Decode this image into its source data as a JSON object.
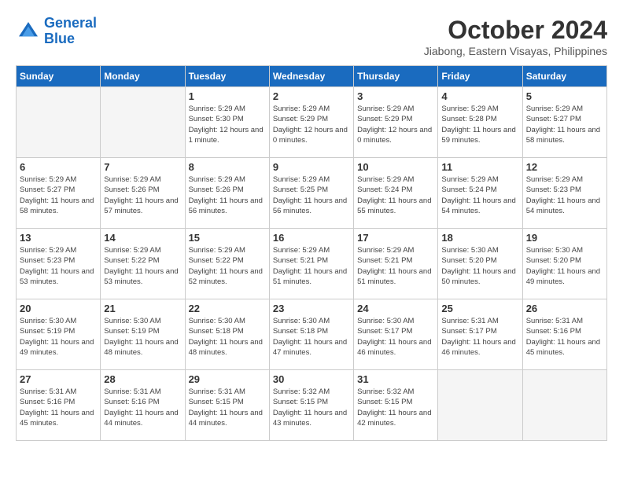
{
  "logo": {
    "line1": "General",
    "line2": "Blue"
  },
  "title": "October 2024",
  "subtitle": "Jiabong, Eastern Visayas, Philippines",
  "weekdays": [
    "Sunday",
    "Monday",
    "Tuesday",
    "Wednesday",
    "Thursday",
    "Friday",
    "Saturday"
  ],
  "weeks": [
    [
      {
        "day": "",
        "sunrise": "",
        "sunset": "",
        "daylight": ""
      },
      {
        "day": "",
        "sunrise": "",
        "sunset": "",
        "daylight": ""
      },
      {
        "day": "1",
        "sunrise": "Sunrise: 5:29 AM",
        "sunset": "Sunset: 5:30 PM",
        "daylight": "Daylight: 12 hours and 1 minute."
      },
      {
        "day": "2",
        "sunrise": "Sunrise: 5:29 AM",
        "sunset": "Sunset: 5:29 PM",
        "daylight": "Daylight: 12 hours and 0 minutes."
      },
      {
        "day": "3",
        "sunrise": "Sunrise: 5:29 AM",
        "sunset": "Sunset: 5:29 PM",
        "daylight": "Daylight: 12 hours and 0 minutes."
      },
      {
        "day": "4",
        "sunrise": "Sunrise: 5:29 AM",
        "sunset": "Sunset: 5:28 PM",
        "daylight": "Daylight: 11 hours and 59 minutes."
      },
      {
        "day": "5",
        "sunrise": "Sunrise: 5:29 AM",
        "sunset": "Sunset: 5:27 PM",
        "daylight": "Daylight: 11 hours and 58 minutes."
      }
    ],
    [
      {
        "day": "6",
        "sunrise": "Sunrise: 5:29 AM",
        "sunset": "Sunset: 5:27 PM",
        "daylight": "Daylight: 11 hours and 58 minutes."
      },
      {
        "day": "7",
        "sunrise": "Sunrise: 5:29 AM",
        "sunset": "Sunset: 5:26 PM",
        "daylight": "Daylight: 11 hours and 57 minutes."
      },
      {
        "day": "8",
        "sunrise": "Sunrise: 5:29 AM",
        "sunset": "Sunset: 5:26 PM",
        "daylight": "Daylight: 11 hours and 56 minutes."
      },
      {
        "day": "9",
        "sunrise": "Sunrise: 5:29 AM",
        "sunset": "Sunset: 5:25 PM",
        "daylight": "Daylight: 11 hours and 56 minutes."
      },
      {
        "day": "10",
        "sunrise": "Sunrise: 5:29 AM",
        "sunset": "Sunset: 5:24 PM",
        "daylight": "Daylight: 11 hours and 55 minutes."
      },
      {
        "day": "11",
        "sunrise": "Sunrise: 5:29 AM",
        "sunset": "Sunset: 5:24 PM",
        "daylight": "Daylight: 11 hours and 54 minutes."
      },
      {
        "day": "12",
        "sunrise": "Sunrise: 5:29 AM",
        "sunset": "Sunset: 5:23 PM",
        "daylight": "Daylight: 11 hours and 54 minutes."
      }
    ],
    [
      {
        "day": "13",
        "sunrise": "Sunrise: 5:29 AM",
        "sunset": "Sunset: 5:23 PM",
        "daylight": "Daylight: 11 hours and 53 minutes."
      },
      {
        "day": "14",
        "sunrise": "Sunrise: 5:29 AM",
        "sunset": "Sunset: 5:22 PM",
        "daylight": "Daylight: 11 hours and 53 minutes."
      },
      {
        "day": "15",
        "sunrise": "Sunrise: 5:29 AM",
        "sunset": "Sunset: 5:22 PM",
        "daylight": "Daylight: 11 hours and 52 minutes."
      },
      {
        "day": "16",
        "sunrise": "Sunrise: 5:29 AM",
        "sunset": "Sunset: 5:21 PM",
        "daylight": "Daylight: 11 hours and 51 minutes."
      },
      {
        "day": "17",
        "sunrise": "Sunrise: 5:29 AM",
        "sunset": "Sunset: 5:21 PM",
        "daylight": "Daylight: 11 hours and 51 minutes."
      },
      {
        "day": "18",
        "sunrise": "Sunrise: 5:30 AM",
        "sunset": "Sunset: 5:20 PM",
        "daylight": "Daylight: 11 hours and 50 minutes."
      },
      {
        "day": "19",
        "sunrise": "Sunrise: 5:30 AM",
        "sunset": "Sunset: 5:20 PM",
        "daylight": "Daylight: 11 hours and 49 minutes."
      }
    ],
    [
      {
        "day": "20",
        "sunrise": "Sunrise: 5:30 AM",
        "sunset": "Sunset: 5:19 PM",
        "daylight": "Daylight: 11 hours and 49 minutes."
      },
      {
        "day": "21",
        "sunrise": "Sunrise: 5:30 AM",
        "sunset": "Sunset: 5:19 PM",
        "daylight": "Daylight: 11 hours and 48 minutes."
      },
      {
        "day": "22",
        "sunrise": "Sunrise: 5:30 AM",
        "sunset": "Sunset: 5:18 PM",
        "daylight": "Daylight: 11 hours and 48 minutes."
      },
      {
        "day": "23",
        "sunrise": "Sunrise: 5:30 AM",
        "sunset": "Sunset: 5:18 PM",
        "daylight": "Daylight: 11 hours and 47 minutes."
      },
      {
        "day": "24",
        "sunrise": "Sunrise: 5:30 AM",
        "sunset": "Sunset: 5:17 PM",
        "daylight": "Daylight: 11 hours and 46 minutes."
      },
      {
        "day": "25",
        "sunrise": "Sunrise: 5:31 AM",
        "sunset": "Sunset: 5:17 PM",
        "daylight": "Daylight: 11 hours and 46 minutes."
      },
      {
        "day": "26",
        "sunrise": "Sunrise: 5:31 AM",
        "sunset": "Sunset: 5:16 PM",
        "daylight": "Daylight: 11 hours and 45 minutes."
      }
    ],
    [
      {
        "day": "27",
        "sunrise": "Sunrise: 5:31 AM",
        "sunset": "Sunset: 5:16 PM",
        "daylight": "Daylight: 11 hours and 45 minutes."
      },
      {
        "day": "28",
        "sunrise": "Sunrise: 5:31 AM",
        "sunset": "Sunset: 5:16 PM",
        "daylight": "Daylight: 11 hours and 44 minutes."
      },
      {
        "day": "29",
        "sunrise": "Sunrise: 5:31 AM",
        "sunset": "Sunset: 5:15 PM",
        "daylight": "Daylight: 11 hours and 44 minutes."
      },
      {
        "day": "30",
        "sunrise": "Sunrise: 5:32 AM",
        "sunset": "Sunset: 5:15 PM",
        "daylight": "Daylight: 11 hours and 43 minutes."
      },
      {
        "day": "31",
        "sunrise": "Sunrise: 5:32 AM",
        "sunset": "Sunset: 5:15 PM",
        "daylight": "Daylight: 11 hours and 42 minutes."
      },
      {
        "day": "",
        "sunrise": "",
        "sunset": "",
        "daylight": ""
      },
      {
        "day": "",
        "sunrise": "",
        "sunset": "",
        "daylight": ""
      }
    ]
  ]
}
